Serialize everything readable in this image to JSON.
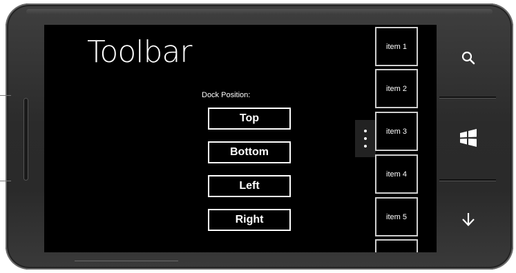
{
  "app": {
    "title": "Toolbar"
  },
  "dock": {
    "label": "Dock Position:",
    "options": [
      "Top",
      "Bottom",
      "Left",
      "Right"
    ]
  },
  "toolbar": {
    "items": [
      "item 1",
      "item 2",
      "item 3",
      "item 4",
      "item 5",
      ""
    ]
  },
  "hardware_buttons": {
    "search_icon": "search-icon",
    "start_icon": "windows-logo-icon",
    "back_icon": "back-arrow-icon"
  },
  "colors": {
    "screen_background": "#000000",
    "text": "#ffffff",
    "button_border": "#ffffff",
    "toolbar_item_border": "#cfcfcf",
    "phone_body": "#2b2b2b"
  }
}
